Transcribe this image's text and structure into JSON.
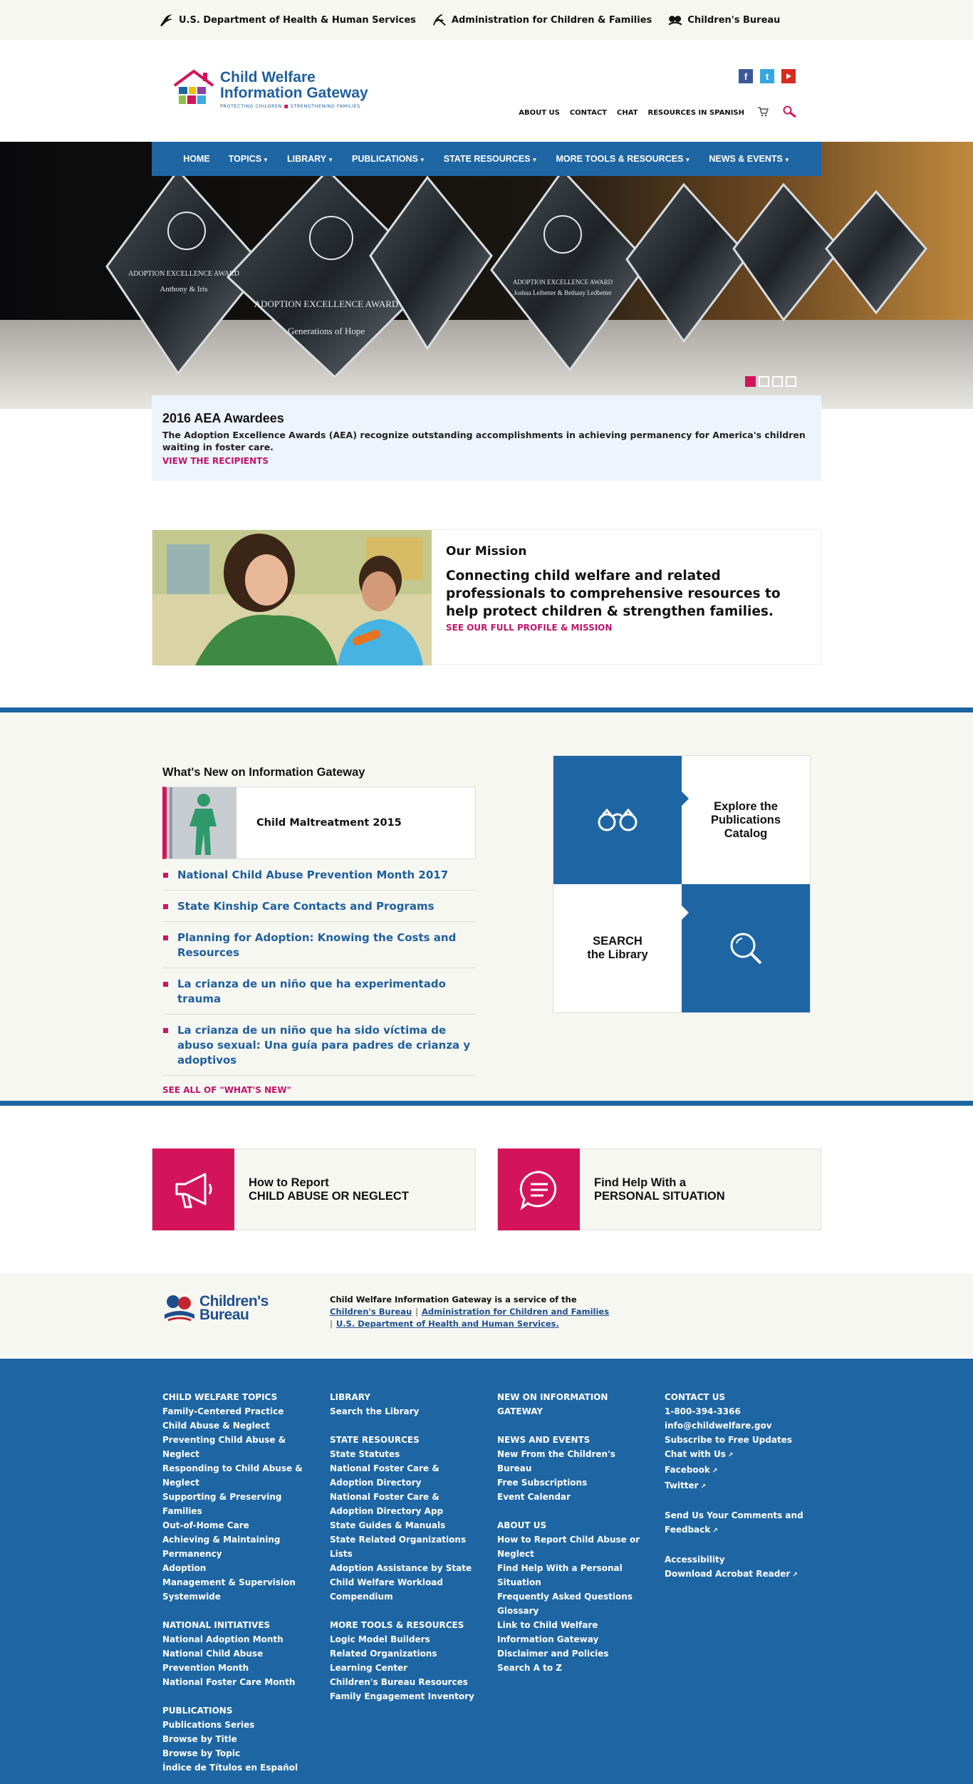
{
  "govbar": {
    "hhs": "U.S. Department of Health & Human Services",
    "acf": "Administration for Children & Families",
    "cb": "Children's Bureau"
  },
  "logo": {
    "line1": "Child Welfare",
    "line2": "Information Gateway",
    "tag_a": "PROTECTING CHILDREN",
    "tag_b": "STRENGTHENING FAMILIES"
  },
  "utility": [
    "ABOUT US",
    "CONTACT",
    "CHAT",
    "RESOURCES IN SPANISH"
  ],
  "social": [
    "facebook-icon",
    "twitter-icon",
    "youtube-icon"
  ],
  "nav": [
    "HOME",
    "TOPICS",
    "LIBRARY",
    "PUBLICATIONS",
    "STATE RESOURCES",
    "MORE TOOLS & RESOURCES",
    "NEWS & EVENTS"
  ],
  "hero": {
    "trophy1": "ADOPTION EXCELLENCE AWARD",
    "trophy1_name": "Anthony & Iris",
    "trophy2": "ADOPTION EXCELLENCE AWARD",
    "trophy2_name": "Generations of Hope",
    "trophy3": "ADOPTION EXCELLENCE AWARD",
    "trophy3_name": "Joshua Leibetter & Bethany Ledbetter",
    "slides": 4,
    "active_slide": 1
  },
  "caption": {
    "title": "2016 AEA Awardees",
    "text": "The Adoption Excellence Awards (AEA) recognize outstanding accomplishments in achieving permanency for America's children waiting in foster care.",
    "link": "VIEW THE RECIPIENTS"
  },
  "mission": {
    "title": "Our Mission",
    "statement": "Connecting child welfare and related professionals to comprehensive resources to help protect children & strengthen families.",
    "link": "SEE OUR FULL PROFILE & MISSION"
  },
  "whats_new": {
    "heading": "What's New on Information Gateway",
    "feature": "Child Maltreatment 2015",
    "items": [
      "National Child Abuse Prevention Month 2017",
      "State Kinship Care Contacts and Programs",
      "Planning for Adoption: Knowing the Costs and Resources",
      "La crianza de un niño que ha experimentado trauma",
      "La crianza de un niño que ha sido víctima de abuso sexual: Una guía para padres de crianza y adoptivos"
    ],
    "see_all": "SEE ALL OF \"WHAT'S NEW\""
  },
  "tiles": {
    "explore": "Explore the Publications Catalog",
    "search_a": "SEARCH",
    "search_b": "the Library"
  },
  "report": {
    "a1": "How to Report",
    "a2": "CHILD ABUSE OR NEGLECT",
    "b1": "Find Help With a",
    "b2": "PERSONAL SITUATION"
  },
  "service": {
    "logo_a": "Children's",
    "logo_b": "Bureau",
    "lead": "Child Welfare Information Gateway is a service of the",
    "link1": "Children's Bureau",
    "link2": "Administration for Children and Families",
    "link3": "U.S. Department of Health and Human Services."
  },
  "footer": {
    "col1": {
      "h1": "CHILD WELFARE TOPICS",
      "items1": [
        "Family-Centered Practice",
        "Child Abuse & Neglect",
        "Preventing Child Abuse & Neglect",
        "Responding to Child Abuse & Neglect",
        "Supporting & Preserving Families",
        "Out-of-Home Care",
        "Achieving & Maintaining Permanency",
        "Adoption",
        "Management & Supervision",
        "Systemwide"
      ],
      "h2": "NATIONAL INITIATIVES",
      "items2": [
        "National Adoption Month",
        "National Child Abuse Prevention Month",
        "National Foster Care Month"
      ],
      "h3": "PUBLICATIONS",
      "items3": [
        "Publications Series",
        "Browse by Title",
        "Browse by Topic",
        "Índice de Títulos en Español"
      ]
    },
    "col2": {
      "h1": "LIBRARY",
      "items1": [
        "Search the Library"
      ],
      "h2": "STATE RESOURCES",
      "items2": [
        "State Statutes",
        "National Foster Care & Adoption Directory",
        "National Foster Care & Adoption Directory App",
        "State Guides & Manuals",
        "State Related Organizations Lists",
        "Adoption Assistance by State",
        "Child Welfare Workload Compendium"
      ],
      "h3": "MORE TOOLS & RESOURCES",
      "items3": [
        "Logic Model Builders",
        "Related Organizations",
        "Learning Center",
        "Children's Bureau Resources",
        "Family Engagement Inventory"
      ]
    },
    "col3": {
      "h1": "NEW ON INFORMATION GATEWAY",
      "h2": "NEWS AND EVENTS",
      "items2": [
        "New From the Children's Bureau",
        "Free Subscriptions",
        "Event Calendar"
      ],
      "h3": "ABOUT US",
      "items3": [
        "How to Report Child Abuse or Neglect",
        "Find Help With a Personal Situation",
        "Frequently Asked Questions",
        "Glossary",
        "Link to Child Welfare Information Gateway",
        "Disclaimer and Policies",
        "Search A to Z"
      ]
    },
    "col4": {
      "h1": "CONTACT US",
      "items1": [
        "1-800-394-3366",
        "info@childwelfare.gov",
        "Subscribe to Free Updates",
        "Chat with Us",
        "Facebook",
        "Twitter"
      ],
      "items2": [
        "Send Us Your Comments and Feedback"
      ],
      "items3": [
        "Accessibility",
        "Download Acrobat Reader"
      ]
    }
  },
  "colors": {
    "blue": "#1e66a3",
    "magenta": "#d4145a",
    "cream": "#f7f7f2"
  }
}
